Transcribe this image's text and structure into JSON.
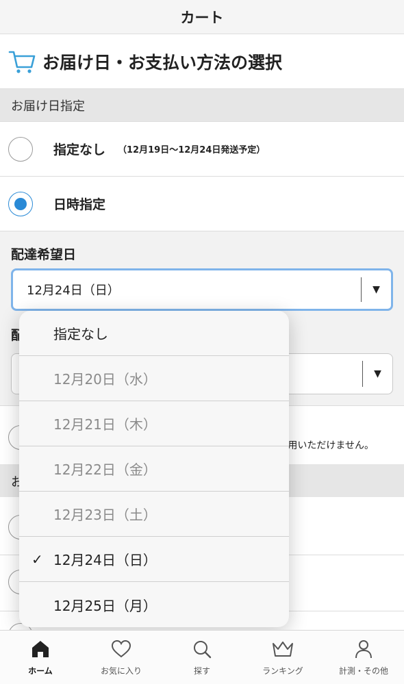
{
  "header": {
    "title": "カート"
  },
  "section": {
    "title": "お届け日・お支払い方法の選択"
  },
  "delivery": {
    "heading": "お届け日指定",
    "options": [
      {
        "label": "指定なし",
        "note": "（12月19日〜12月24日発送予定）",
        "selected": false
      },
      {
        "label": "日時指定",
        "selected": true
      }
    ],
    "date_label": "配達希望日",
    "date_value": "12月24日（日）",
    "time_label_partial": "配",
    "arrow": "▼"
  },
  "background": {
    "note_partial": "用いただけません。",
    "heading_partial": "お"
  },
  "dropdown": {
    "items": [
      {
        "label": "指定なし",
        "disabled": false,
        "checked": false
      },
      {
        "label": "12月20日（水）",
        "disabled": true,
        "checked": false
      },
      {
        "label": "12月21日（木）",
        "disabled": true,
        "checked": false
      },
      {
        "label": "12月22日（金）",
        "disabled": true,
        "checked": false
      },
      {
        "label": "12月23日（土）",
        "disabled": true,
        "checked": false
      },
      {
        "label": "12月24日（日）",
        "disabled": false,
        "checked": true
      },
      {
        "label": "12月25日（月）",
        "disabled": false,
        "checked": false
      }
    ],
    "check_glyph": "✓"
  },
  "tabs": [
    {
      "label": "ホーム",
      "icon": "home-icon",
      "active": true
    },
    {
      "label": "お気に入り",
      "icon": "heart-icon",
      "active": false
    },
    {
      "label": "探す",
      "icon": "search-icon",
      "active": false
    },
    {
      "label": "ランキング",
      "icon": "crown-icon",
      "active": false
    },
    {
      "label": "計測・その他",
      "icon": "person-icon",
      "active": false
    }
  ],
  "colors": {
    "accent": "#2a8ad6",
    "focus_border": "#7fb4ea",
    "cart_icon": "#3aa0d8"
  }
}
